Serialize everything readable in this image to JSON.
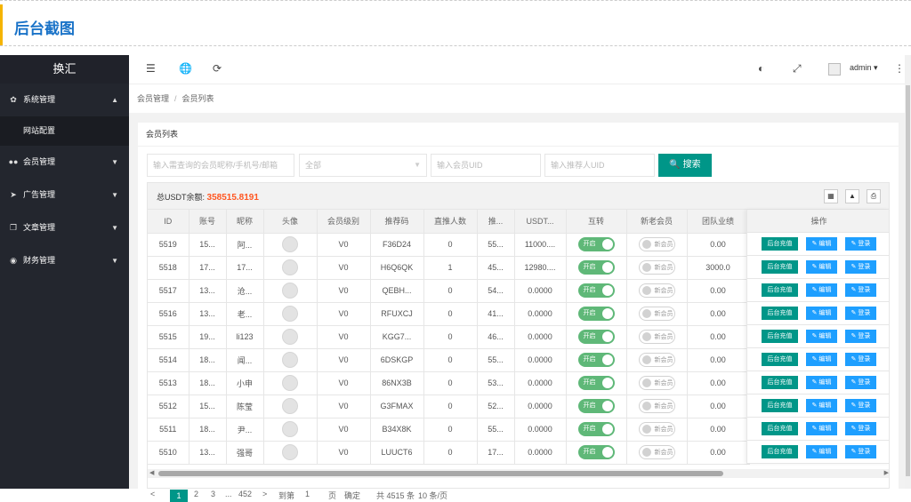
{
  "banner": {
    "title": "后台截图"
  },
  "sidebar": {
    "logo": "换汇",
    "menus": [
      {
        "label": "系统管理",
        "icon": "gear-icon",
        "glyph": "✿",
        "caret": "▲"
      },
      {
        "label": "会员管理",
        "icon": "users-icon",
        "glyph": "👥",
        "caret": "▼"
      },
      {
        "label": "广告管理",
        "icon": "megaphone-icon",
        "glyph": "➤",
        "caret": "▼"
      },
      {
        "label": "文章管理",
        "icon": "copy-icon",
        "glyph": "❐",
        "caret": "▼"
      },
      {
        "label": "财务管理",
        "icon": "money-icon",
        "glyph": "◉",
        "caret": "▼"
      }
    ],
    "submenu": {
      "label": "网站配置"
    }
  },
  "topbar": {
    "icons": [
      "menu-toggle-icon",
      "globe-icon",
      "refresh-icon",
      "theme-icon",
      "fullscreen-icon",
      "more-icon"
    ],
    "user": "admin ▾"
  },
  "breadcrumb": {
    "parent": "会员管理",
    "current": "会员列表"
  },
  "card": {
    "title": "会员列表"
  },
  "filters": {
    "keyword_placeholder": "输入需查询的会员昵称/手机号/邮箱",
    "level_selected": "全部",
    "uid_placeholder": "输入会员UID",
    "ref_placeholder": "输入推荐人UID",
    "search_label": "搜索"
  },
  "summary": {
    "label": "总USDT余额:",
    "value": "358515.8191"
  },
  "table": {
    "columns": [
      "ID",
      "账号",
      "昵称",
      "头像",
      "会员级别",
      "推荐码",
      "直推人数",
      "推...",
      "USDT...",
      "互转",
      "新老会员",
      "团队业绩",
      "操作"
    ],
    "switch_on_label": "开启",
    "switch_off_label": "新会员",
    "rows": [
      {
        "id": "5519",
        "account": "15...",
        "nick": "阿...",
        "level": "V0",
        "code": "F36D24",
        "direct": "0",
        "team": "55...",
        "usdt": "11000....",
        "transfer": "开启",
        "member": "新会员",
        "perf": "0.00"
      },
      {
        "id": "5518",
        "account": "17...",
        "nick": "17...",
        "level": "V0",
        "code": "H6Q6QK",
        "direct": "1",
        "team": "45...",
        "usdt": "12980....",
        "transfer": "开启",
        "member": "新会员",
        "perf": "3000.0"
      },
      {
        "id": "5517",
        "account": "13...",
        "nick": "沧...",
        "level": "V0",
        "code": "QEBH...",
        "direct": "0",
        "team": "54...",
        "usdt": "0.0000",
        "transfer": "开启",
        "member": "新会员",
        "perf": "0.00"
      },
      {
        "id": "5516",
        "account": "13...",
        "nick": "老...",
        "level": "V0",
        "code": "RFUXCJ",
        "direct": "0",
        "team": "41...",
        "usdt": "0.0000",
        "transfer": "开启",
        "member": "新会员",
        "perf": "0.00"
      },
      {
        "id": "5515",
        "account": "19...",
        "nick": "li123",
        "level": "V0",
        "code": "KGG7...",
        "direct": "0",
        "team": "46...",
        "usdt": "0.0000",
        "transfer": "开启",
        "member": "新会员",
        "perf": "0.00"
      },
      {
        "id": "5514",
        "account": "18...",
        "nick": "闻...",
        "level": "V0",
        "code": "6DSKGP",
        "direct": "0",
        "team": "55...",
        "usdt": "0.0000",
        "transfer": "开启",
        "member": "新会员",
        "perf": "0.00"
      },
      {
        "id": "5513",
        "account": "18...",
        "nick": "小申",
        "level": "V0",
        "code": "86NX3B",
        "direct": "0",
        "team": "53...",
        "usdt": "0.0000",
        "transfer": "开启",
        "member": "新会员",
        "perf": "0.00"
      },
      {
        "id": "5512",
        "account": "15...",
        "nick": "陈莹",
        "level": "V0",
        "code": "G3FMAX",
        "direct": "0",
        "team": "52...",
        "usdt": "0.0000",
        "transfer": "开启",
        "member": "新会员",
        "perf": "0.00"
      },
      {
        "id": "5511",
        "account": "18...",
        "nick": "尹...",
        "level": "V0",
        "code": "B34X8K",
        "direct": "0",
        "team": "55...",
        "usdt": "0.0000",
        "transfer": "开启",
        "member": "新会员",
        "perf": "0.00"
      },
      {
        "id": "5510",
        "account": "13...",
        "nick": "强哥",
        "level": "V0",
        "code": "LUUCT6",
        "direct": "0",
        "team": "17...",
        "usdt": "0.0000",
        "transfer": "开启",
        "member": "新会员",
        "perf": "0.00"
      }
    ],
    "actions": {
      "recharge": "后台充值",
      "edit": "✎ 编辑",
      "login": "✎ 登录"
    }
  },
  "pager": {
    "prev": "<",
    "p1": "1",
    "p2": "2",
    "p3": "3",
    "ellipsis": "...",
    "last": "452",
    "next": ">",
    "goto": "到第",
    "page_val": "1",
    "page_unit": "页",
    "confirm": "确定",
    "total": "共 4515 条",
    "size": "10 条/页"
  },
  "colors": {
    "accent": "#009688",
    "blue": "#1e9fff",
    "switch_on": "#5fb878",
    "total": "#ff5722",
    "sidebar": "#23262e"
  }
}
